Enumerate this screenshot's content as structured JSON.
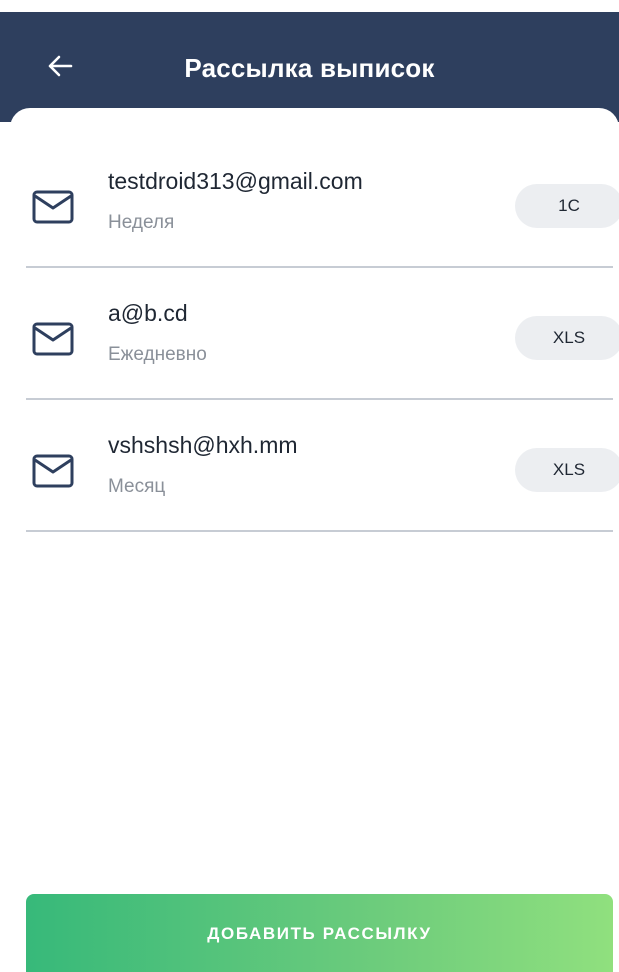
{
  "header": {
    "title": "Рассылка выписок",
    "background_color": "#2e3f5e",
    "back_icon": "arrow-left-icon"
  },
  "subscriptions": [
    {
      "email": "testdroid313@gmail.com",
      "period": "Неделя",
      "format": "1C",
      "icon": "mail-icon"
    },
    {
      "email": "a@b.cd",
      "period": "Ежедневно",
      "format": "XLS",
      "icon": "mail-icon"
    },
    {
      "email": "vshshsh@hxh.mm",
      "period": "Месяц",
      "format": "XLS",
      "icon": "mail-icon"
    }
  ],
  "add_button": {
    "label": "ДОБАВИТЬ РАССЫЛКУ",
    "gradient_start": "#37b97a",
    "gradient_end": "#90e07e"
  },
  "colors": {
    "divider": "#c7ccd4",
    "badge_bg": "#eceef1",
    "secondary_text": "#8a9099",
    "primary_text": "#1f2733",
    "icon_stroke": "#2e3f5e"
  }
}
